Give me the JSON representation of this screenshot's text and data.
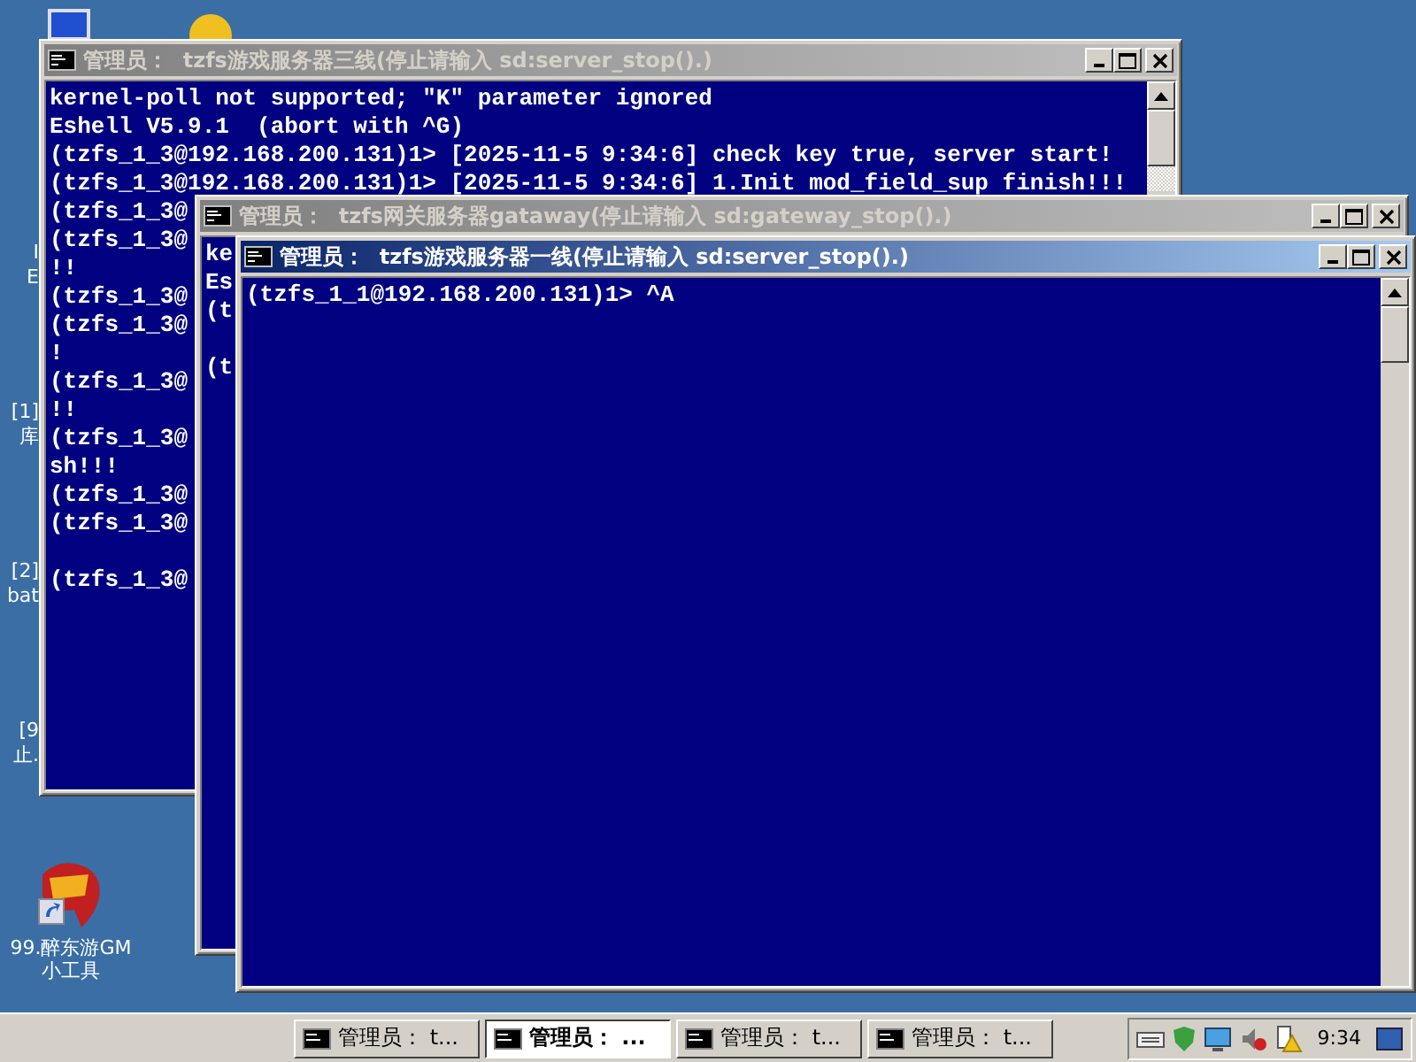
{
  "desktop": {
    "partial_labels": [
      {
        "lines": [
          "I",
          "E"
        ]
      },
      {
        "lines": [
          "[1]",
          "库"
        ]
      },
      {
        "lines": [
          "[2]",
          "bat"
        ]
      },
      {
        "lines": [
          "[9",
          "止."
        ]
      }
    ],
    "shortcut": {
      "lines": [
        "99.醉东游GM",
        "小工具"
      ]
    }
  },
  "windows": [
    {
      "title": "管理员：  tzfs游戏服务器三线(停止请输入 sd:server_stop().)",
      "active": false,
      "blocks": [
        [
          "kernel-poll not supported; \"K\" parameter ignored",
          "Eshell V5.9.1  (abort with ^G)",
          "(tzfs_1_3@192.168.200.131)1> [2025-11-5 9:34:6] check key true, server start!",
          "(tzfs_1_3@192.168.200.131)1> [2025-11-5 9:34:6] 1.Init mod_field_sup finish!!!",
          "(tzfs_1_3@",
          "(tzfs_1_3@",
          "!!",
          "(tzfs_1_3@",
          "(tzfs_1_3@",
          "!",
          "(tzfs_1_3@",
          "!!",
          "(tzfs_1_3@",
          "sh!!!",
          "(tzfs_1_3@",
          "(tzfs_1_3@"
        ],
        [
          "(tzfs_1_3@"
        ]
      ]
    },
    {
      "title": "管理员：  tzfs网关服务器gataway(停止请输入 sd:gateway_stop().)",
      "active": false,
      "blocks": [
        [
          "ke",
          "Es",
          "(t"
        ],
        [
          "(t"
        ]
      ]
    },
    {
      "title": "管理员：  tzfs游戏服务器一线(停止请输入 sd:server_stop().)",
      "active": true,
      "blocks": [
        [
          "(tzfs_1_1@192.168.200.131)1> ^A"
        ]
      ]
    }
  ],
  "taskbar": {
    "buttons": [
      {
        "label": "管理员： t...",
        "selected": false
      },
      {
        "label": "管理员： ...",
        "selected": true
      },
      {
        "label": "管理员： t...",
        "selected": false
      },
      {
        "label": "管理员： t...",
        "selected": false
      }
    ],
    "clock": "9:34"
  }
}
